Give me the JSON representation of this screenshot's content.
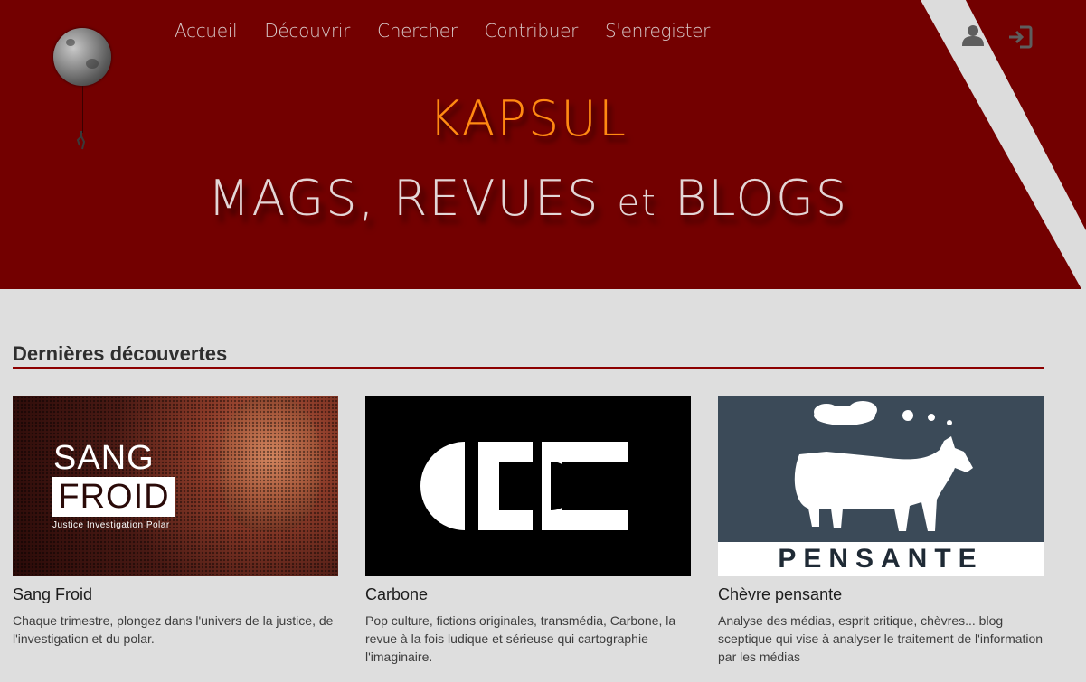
{
  "nav": {
    "items": [
      "Accueil",
      "Découvrir",
      "Chercher",
      "Contribuer",
      "S'enregister"
    ]
  },
  "header": {
    "brand": "KAPSUL",
    "tagline_part1": "MAGS, REVUES ",
    "tagline_et": "et",
    "tagline_part2": " BLOGS",
    "icons": [
      "user-icon",
      "login-icon"
    ]
  },
  "section": {
    "title": "Dernières découvertes"
  },
  "cards": [
    {
      "title": "Sang Froid",
      "description": "Chaque trimestre, plongez dans l'univers de la justice, de l'investigation et du polar.",
      "logo_line1": "SANG",
      "logo_line2": "FROID",
      "logo_sub": "Justice Investigation Polar"
    },
    {
      "title": "Carbone",
      "description": "Pop culture, fictions originales, transmédia, Carbone, la revue à la fois ludique et sérieuse qui cartographie l'imaginaire."
    },
    {
      "title": "Chèvre pensante",
      "description": "Analyse des médias, esprit critique, chèvres... blog sceptique qui vise à analyser le traitement de l'information par les médias",
      "logo_word": "PENSANTE"
    }
  ],
  "colors": {
    "header_bg": "#730000",
    "brand": "#ff8a12",
    "accent_rule": "#8c0000",
    "page_bg": "#dedede"
  }
}
